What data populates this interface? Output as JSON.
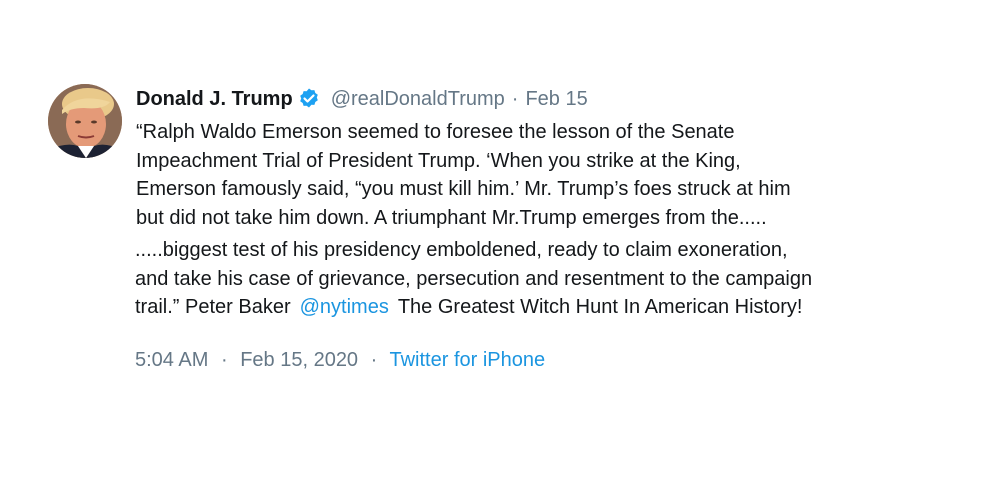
{
  "tweet": {
    "author_name": "Donald J. Trump",
    "handle": "@realDonaldTrump",
    "separator": "·",
    "date_short": "Feb 15",
    "text_part1": "“Ralph Waldo Emerson seemed to foresee the lesson of the Senate\nImpeachment Trial of President Trump. ‘When you strike at the King,\nEmerson famously said, “you must kill him.’ Mr. Trump’s foes struck at him\nbut did not take him down. A triumphant Mr.Trump emerges from the.....",
    "text_part2_line1": ".....biggest test of his presidency emboldened, ready to claim exoneration,",
    "text_part2_line2": "and take his case of grievance, persecution and resentment to the campaign",
    "text_part2_line3_a": "trail.” Peter Baker",
    "mention": "@nytimes",
    "text_part2_line3_b": "The Greatest Witch Hunt In American History!",
    "time": "5:04 AM",
    "full_date": "Feb 15, 2020",
    "source": "Twitter for iPhone",
    "verified_icon": "verified-badge-icon",
    "colors": {
      "text": "#14171a",
      "secondary": "#657786",
      "link": "#1b95e0",
      "verified": "#1da1f2"
    }
  }
}
